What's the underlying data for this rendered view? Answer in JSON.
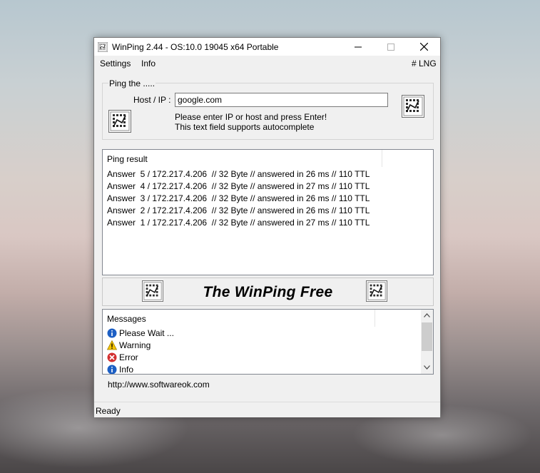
{
  "window": {
    "title": "WinPing 2.44 - OS:10.0 19045 x64 Portable"
  },
  "menu": {
    "settings": "Settings",
    "info": "Info",
    "lng": "# LNG"
  },
  "ping_group": {
    "label": "Ping the .....",
    "host_label": "Host / IP :",
    "host_value": "google.com",
    "hint_line1": "Please enter IP or host and press Enter!",
    "hint_line2": "This text field supports autocomplete"
  },
  "result": {
    "header": "Ping result",
    "lines": [
      "Answer  5 / 172.217.4.206  // 32 Byte // answered in 26 ms // 110 TTL",
      "Answer  4 / 172.217.4.206  // 32 Byte // answered in 27 ms // 110 TTL",
      "Answer  3 / 172.217.4.206  // 32 Byte // answered in 26 ms // 110 TTL",
      "Answer  2 / 172.217.4.206  // 32 Byte // answered in 26 ms // 110 TTL",
      "Answer  1 / 172.217.4.206  // 32 Byte // answered in 27 ms // 110 TTL"
    ]
  },
  "banner": {
    "text": "The WinPing Free"
  },
  "messages": {
    "header": "Messages",
    "items": [
      {
        "icon": "info-icon",
        "text": "Please Wait ..."
      },
      {
        "icon": "warning-icon",
        "text": "Warning"
      },
      {
        "icon": "error-icon",
        "text": "Error"
      },
      {
        "icon": "info-icon",
        "text": "Info"
      }
    ]
  },
  "footer": {
    "url": "http://www.softwareok.com",
    "status": "Ready"
  },
  "colors": {
    "info_blue": "#1c5fc4",
    "warning_yellow": "#f5c400",
    "error_red": "#d32f2f",
    "window_bg": "#f0f0f0"
  }
}
